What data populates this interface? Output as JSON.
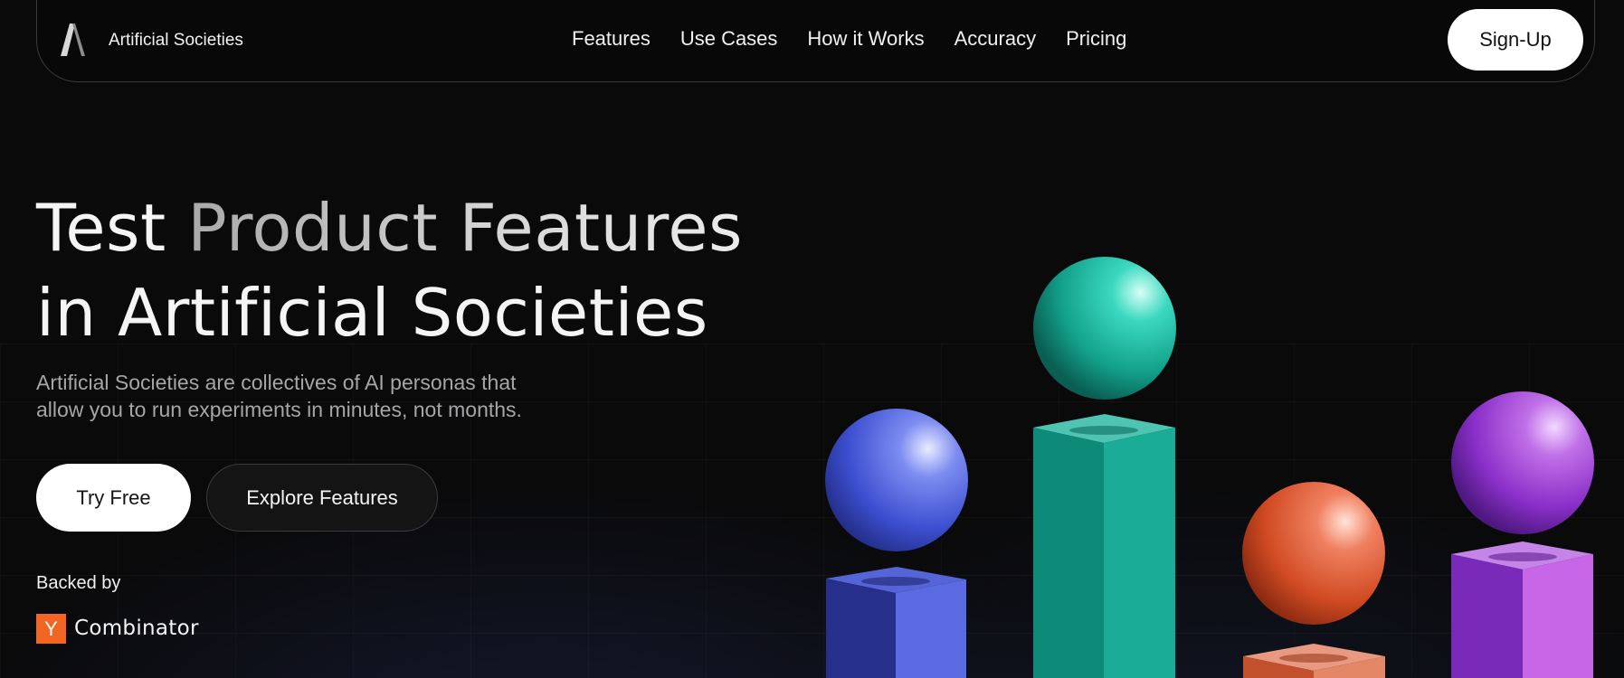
{
  "nav": {
    "brand": "Artificial Societies",
    "links": [
      "Features",
      "Use Cases",
      "How it Works",
      "Accuracy",
      "Pricing"
    ],
    "signup_label": "Sign-Up"
  },
  "hero": {
    "title_line1_part1": "Test",
    "title_line1_part2": "Product Features",
    "title_line2": "in Artificial Societies",
    "subtitle_line1": "Artificial Societies are collectives of AI personas that",
    "subtitle_line2": "allow you to run experiments in minutes, not months.",
    "primary_button": "Try Free",
    "secondary_button": "Explore Features"
  },
  "backing": {
    "label": "Backed by",
    "badge_letter": "Y",
    "name": "Combinator"
  },
  "illustration": {
    "objects": [
      {
        "name": "blue",
        "color": "#4f63dd"
      },
      {
        "name": "teal",
        "color": "#1aae98"
      },
      {
        "name": "orange",
        "color": "#e2552e"
      },
      {
        "name": "purple",
        "color": "#9b3fd4"
      }
    ]
  },
  "colors": {
    "background": "#0a0a0b",
    "accent_yc": "#f26522",
    "button_light": "#ffffff"
  }
}
